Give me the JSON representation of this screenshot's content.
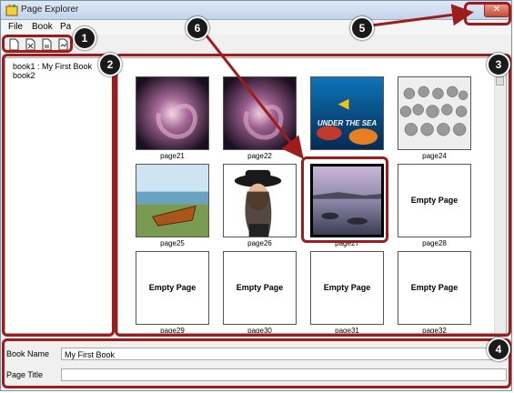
{
  "window": {
    "title": "Page Explorer",
    "close_label": "✕"
  },
  "menu": {
    "items": [
      "File",
      "Book",
      "Pa"
    ]
  },
  "toolbar": {
    "buttons": [
      "new-page-icon",
      "delete-page-icon",
      "edit-page-icon",
      "export-page-icon"
    ]
  },
  "books": [
    "book1 : My First Book",
    "book2"
  ],
  "pages": [
    {
      "label": "page21",
      "image": "swirl"
    },
    {
      "label": "page22",
      "image": "swirl"
    },
    {
      "label": "",
      "image": "under-the-sea",
      "image_text": "UNDER THE SEA"
    },
    {
      "label": "page24",
      "image": "crowd-drawing"
    },
    {
      "label": "page25",
      "image": "boat"
    },
    {
      "label": "page26",
      "image": "woman-hat"
    },
    {
      "label": "page27",
      "image": "lake"
    },
    {
      "label": "page28",
      "image": "empty",
      "empty_text": "Empty Page"
    },
    {
      "label": "page29",
      "image": "empty",
      "empty_text": "Empty Page"
    },
    {
      "label": "page30",
      "image": "empty",
      "empty_text": "Empty Page"
    },
    {
      "label": "page31",
      "image": "empty",
      "empty_text": "Empty Page"
    },
    {
      "label": "page32",
      "image": "empty",
      "empty_text": "Empty Page"
    }
  ],
  "properties": {
    "book_name_label": "Book Name",
    "book_name_value": "My First Book",
    "page_title_label": "Page Title",
    "page_title_value": ""
  },
  "callouts": [
    "1",
    "2",
    "3",
    "4",
    "5",
    "6"
  ],
  "colors": {
    "callout_border": "#9e1c1c",
    "callout_badge": "#1a1a1a"
  }
}
